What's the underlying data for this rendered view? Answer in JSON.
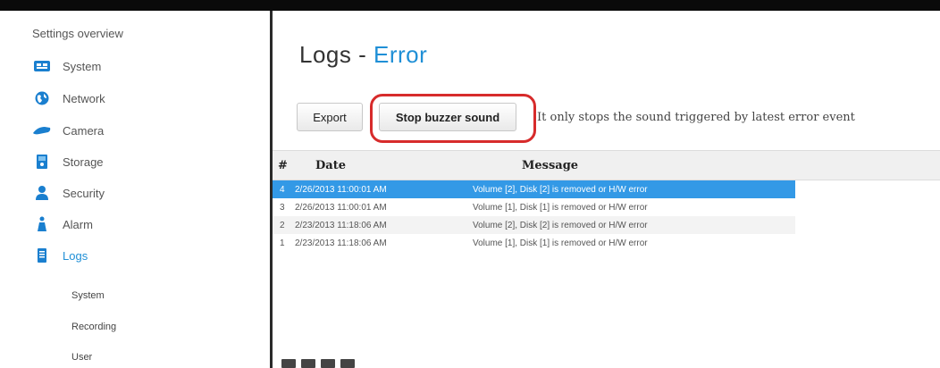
{
  "sidebar": {
    "title": "Settings overview",
    "items": [
      {
        "label": "System",
        "icon": "system-icon"
      },
      {
        "label": "Network",
        "icon": "globe-icon"
      },
      {
        "label": "Camera",
        "icon": "camera-icon"
      },
      {
        "label": "Storage",
        "icon": "storage-icon"
      },
      {
        "label": "Security",
        "icon": "user-icon"
      },
      {
        "label": "Alarm",
        "icon": "alarm-icon"
      },
      {
        "label": "Logs",
        "icon": "logs-icon"
      }
    ],
    "subitems": [
      {
        "label": "System"
      },
      {
        "label": "Recording"
      },
      {
        "label": "User"
      }
    ]
  },
  "main": {
    "title_prefix": "Logs - ",
    "title_accent": "Error",
    "toolbar": {
      "export_label": "Export",
      "stop_label": "Stop buzzer sound",
      "note": "It only stops the sound triggered by latest error event"
    },
    "table": {
      "columns": [
        "#",
        "Date",
        "Message"
      ],
      "rows": [
        {
          "num": "4",
          "date": "2/26/2013 11:00:01 AM",
          "message": "Volume [2], Disk [2] is removed or H/W error"
        },
        {
          "num": "3",
          "date": "2/26/2013 11:00:01 AM",
          "message": "Volume [1], Disk [1] is removed or H/W error"
        },
        {
          "num": "2",
          "date": "2/23/2013 11:18:06 AM",
          "message": "Volume [2], Disk [2] is removed or H/W error"
        },
        {
          "num": "1",
          "date": "2/23/2013 11:18:06 AM",
          "message": "Volume [1], Disk [1] is removed or H/W error"
        }
      ]
    }
  },
  "colors": {
    "accent": "#1f8fd6",
    "selected_row": "#3399e6",
    "highlight": "#d72b2b"
  }
}
